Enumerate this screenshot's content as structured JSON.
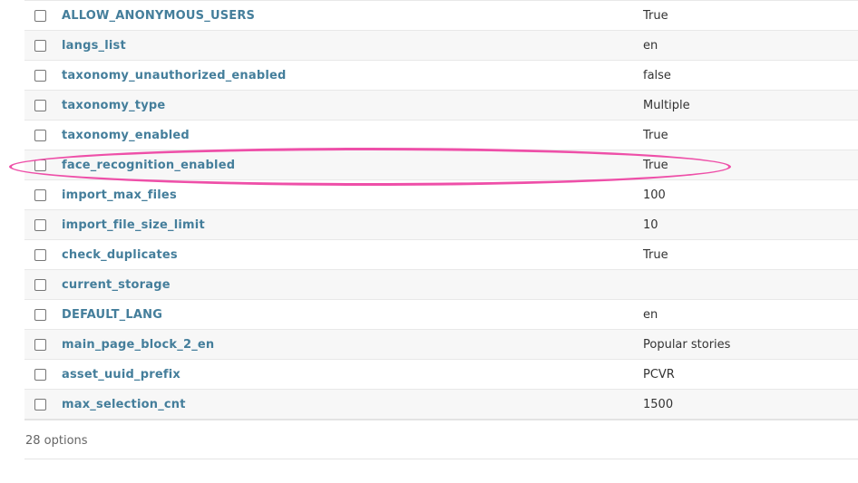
{
  "rows": [
    {
      "name": "ALLOW_ANONYMOUS_USERS",
      "value": "True"
    },
    {
      "name": "langs_list",
      "value": "en"
    },
    {
      "name": "taxonomy_unauthorized_enabled",
      "value": "false"
    },
    {
      "name": "taxonomy_type",
      "value": "Multiple"
    },
    {
      "name": "taxonomy_enabled",
      "value": "True"
    },
    {
      "name": "face_recognition_enabled",
      "value": "True"
    },
    {
      "name": "import_max_files",
      "value": "100"
    },
    {
      "name": "import_file_size_limit",
      "value": "10"
    },
    {
      "name": "check_duplicates",
      "value": "True"
    },
    {
      "name": "current_storage",
      "value": ""
    },
    {
      "name": "DEFAULT_LANG",
      "value": "en"
    },
    {
      "name": "main_page_block_2_en",
      "value": "Popular stories"
    },
    {
      "name": "asset_uuid_prefix",
      "value": "PCVR"
    },
    {
      "name": "max_selection_cnt",
      "value": "1500"
    }
  ],
  "footer": {
    "count_label": "28 options"
  },
  "highlight": {
    "target_row": "face_recognition_enabled",
    "color": "#ee4fa8"
  },
  "colors": {
    "link": "#447e9b",
    "row_alt": "#f7f7f7"
  }
}
